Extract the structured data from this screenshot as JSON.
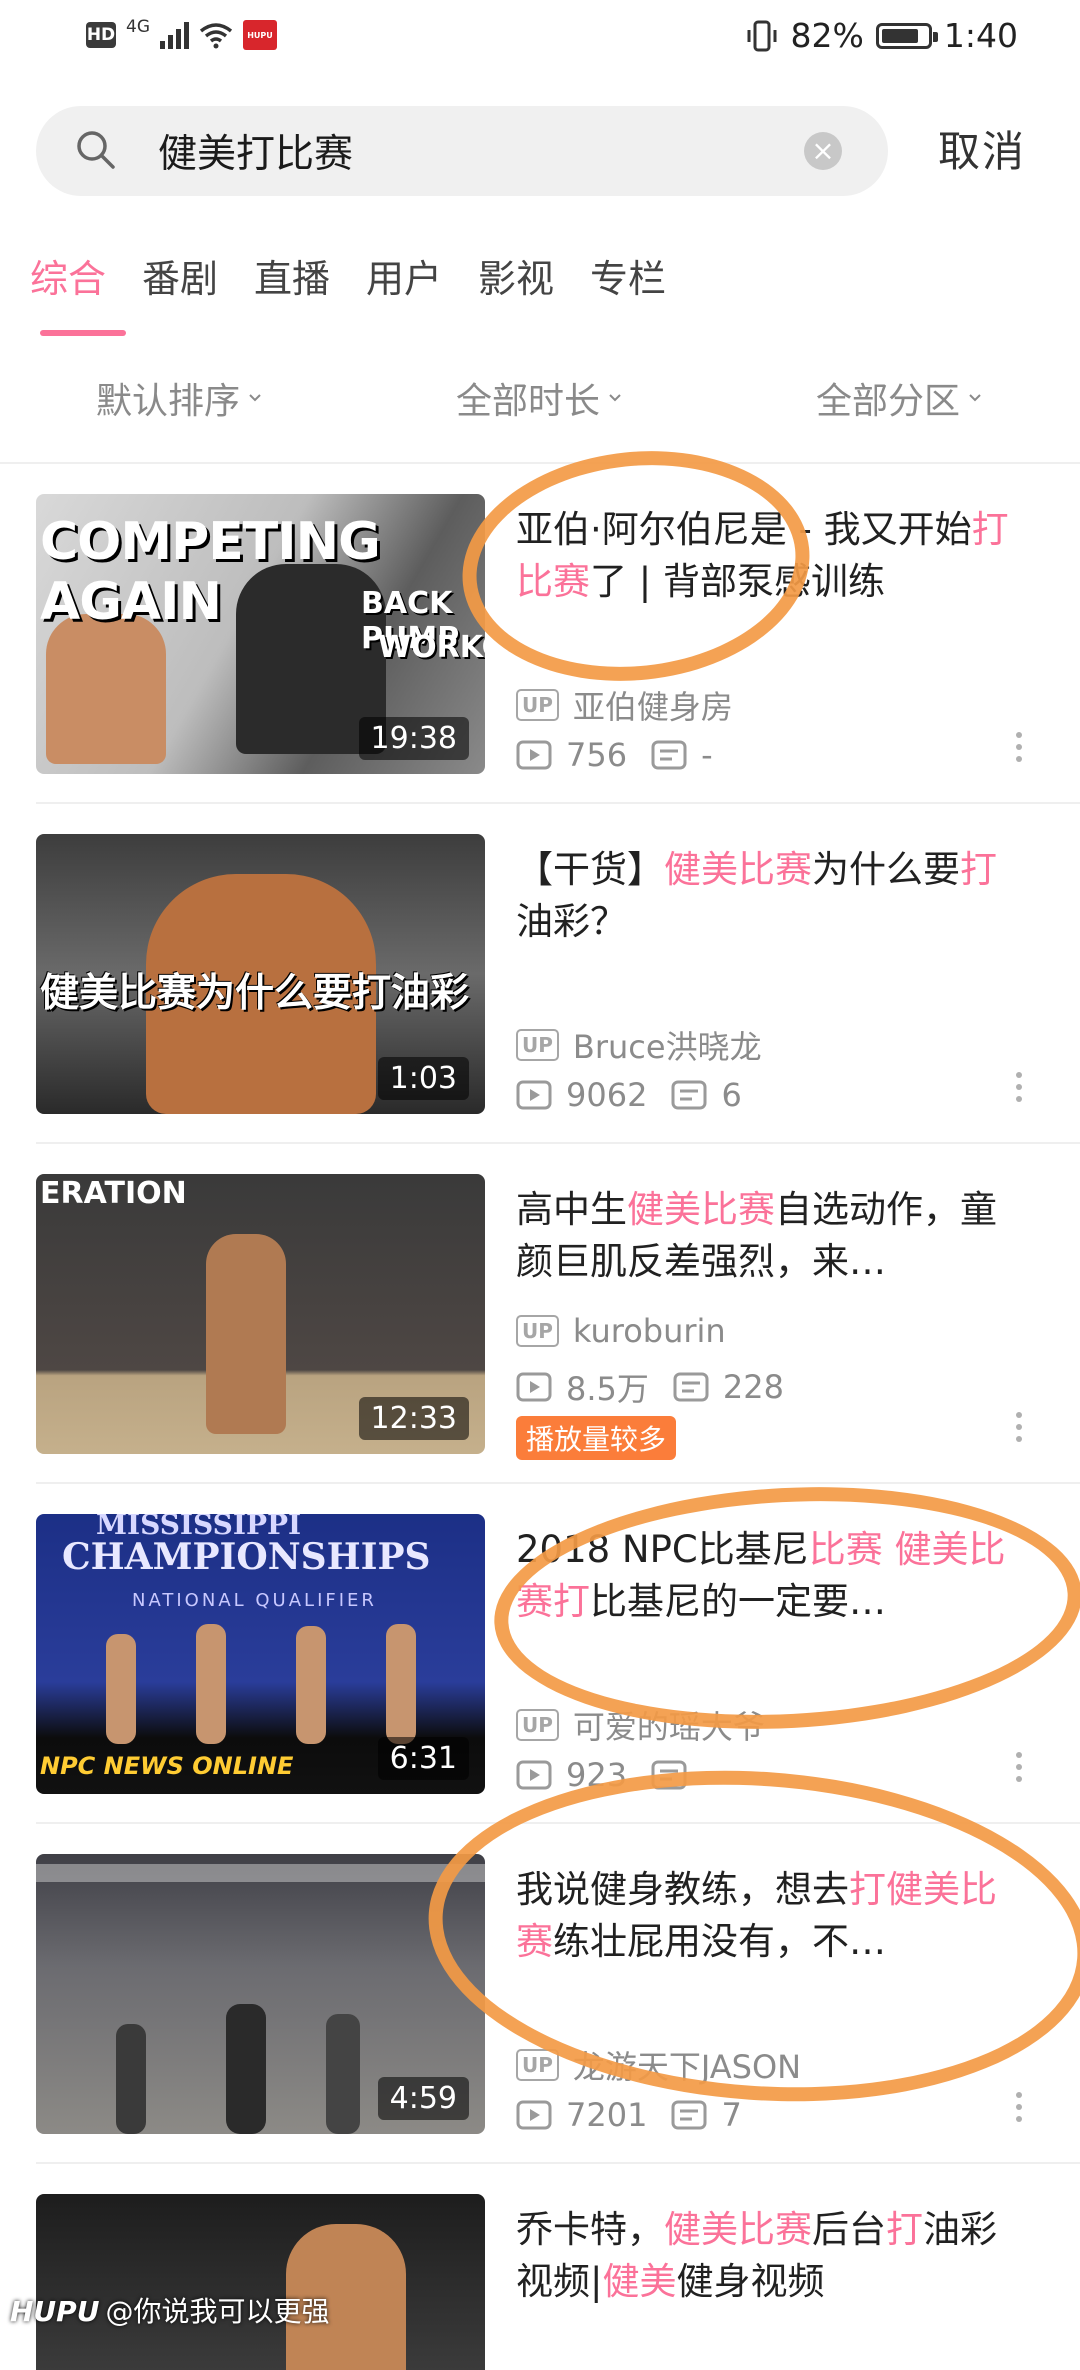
{
  "status_bar": {
    "hd": "HD",
    "network": "4G",
    "battery": "82%",
    "time": "1:40",
    "battery_level": 0.82
  },
  "search": {
    "query": "健美打比赛",
    "cancel_label": "取消"
  },
  "tabs": [
    {
      "label": "综合",
      "active": true
    },
    {
      "label": "番剧"
    },
    {
      "label": "直播"
    },
    {
      "label": "用户"
    },
    {
      "label": "影视"
    },
    {
      "label": "专栏"
    }
  ],
  "filters": [
    "默认排序",
    "全部时长",
    "全部分区"
  ],
  "results": [
    {
      "title_parts": [
        [
          "亚伯·阿尔伯尼是 - 我又开始",
          false
        ],
        [
          "打比赛",
          true
        ],
        [
          "了 | 背部泵感训练",
          false
        ]
      ],
      "thumb_text": [
        "COMPETING AGAIN",
        "BACK PUMP",
        "WORKOUT"
      ],
      "duration": "19:38",
      "uploader": "亚伯健身房",
      "views": "756",
      "comments": "-"
    },
    {
      "title_parts": [
        [
          "【干货】",
          false
        ],
        [
          "健美比赛",
          true
        ],
        [
          "为什么要",
          false
        ],
        [
          "打",
          true
        ],
        [
          "油彩？",
          false
        ]
      ],
      "thumb_text": [
        "健美比赛为什么要打油彩"
      ],
      "duration": "1:03",
      "uploader": "Bruce洪晓龙",
      "views": "9062",
      "comments": "6"
    },
    {
      "title_parts": [
        [
          "高中生",
          false
        ],
        [
          "健美比赛",
          true
        ],
        [
          "自选动作，童颜巨肌反差强烈，来…",
          false
        ]
      ],
      "thumb_text": [
        "ERATION"
      ],
      "duration": "12:33",
      "uploader": "kuroburin",
      "views": "8.5万",
      "comments": "228",
      "tag": "播放量较多"
    },
    {
      "title_parts": [
        [
          "2018 NPC比基尼",
          false
        ],
        [
          "比赛",
          true
        ],
        [
          " ",
          false
        ],
        [
          "健美比赛",
          true
        ],
        [
          "打",
          true
        ],
        [
          "比基尼的一定要…",
          false
        ]
      ],
      "thumb_text": [
        "MISSISSIPPI",
        "CHAMPIONSHIPS",
        "NATIONAL QUALIFIER",
        "NPC NEWS ONLINE"
      ],
      "duration": "6:31",
      "uploader": "可爱的瑶大爷",
      "views": "923",
      "comments": ""
    },
    {
      "title_parts": [
        [
          "我说健身教练，想去",
          false
        ],
        [
          "打健美比赛",
          true
        ],
        [
          "练壮屁用没有，不…",
          false
        ]
      ],
      "thumb_text": [],
      "duration": "4:59",
      "uploader": "龙游天下JASON",
      "views": "7201",
      "comments": "7"
    },
    {
      "title_parts": [
        [
          "乔卡特，",
          false
        ],
        [
          "健美比赛",
          true
        ],
        [
          "后台",
          false
        ],
        [
          "打",
          true
        ],
        [
          "油彩视频|",
          false
        ],
        [
          "健美",
          true
        ],
        [
          "健身视频",
          false
        ]
      ],
      "thumb_text": [],
      "duration": "",
      "uploader": "",
      "views": "",
      "comments": ""
    }
  ],
  "watermark": {
    "brand": "HUPU",
    "user": "@你说我可以更强"
  },
  "colors": {
    "accent": "#fb7299",
    "annotation": "#f39a45",
    "tag": "#fb7d3a"
  }
}
